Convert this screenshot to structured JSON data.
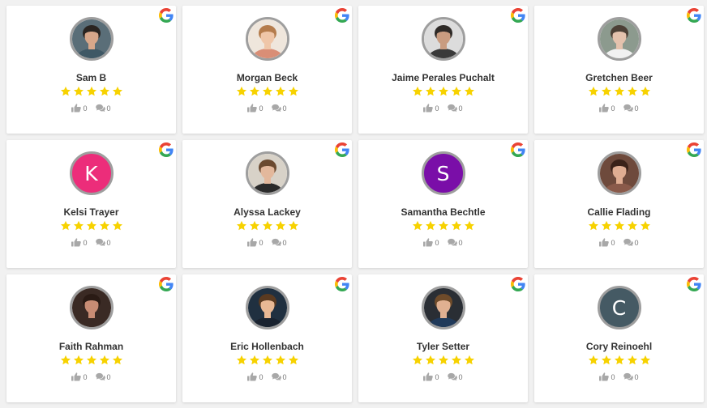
{
  "colors": {
    "star": "#f7d200",
    "avatar_border": "#9e9e9e"
  },
  "reviews": [
    {
      "name": "Sam B",
      "rating": 5,
      "likes": "0",
      "comments": "0",
      "avatar": {
        "type": "photo",
        "bg": "#5a6e78",
        "skin": "#d7a78a",
        "hair": "#2a2521",
        "shirt": "#3f5865"
      }
    },
    {
      "name": "Morgan Beck",
      "rating": 5,
      "likes": "0",
      "comments": "0",
      "avatar": {
        "type": "photo",
        "bg": "#efe6dc",
        "skin": "#efc6a8",
        "hair": "#b57c4c",
        "shirt": "#d98e76"
      }
    },
    {
      "name": "Jaime Perales Puchalt",
      "rating": 5,
      "likes": "0",
      "comments": "0",
      "avatar": {
        "type": "photo",
        "bg": "#dcdcdc",
        "skin": "#c99c80",
        "hair": "#2e2a27",
        "shirt": "#3a3a3a"
      }
    },
    {
      "name": "Gretchen Beer",
      "rating": 5,
      "likes": "0",
      "comments": "0",
      "avatar": {
        "type": "photo",
        "bg": "#8c9a8e",
        "skin": "#e4c2ad",
        "hair": "#4c4036",
        "shirt": "#f1f1f1"
      }
    },
    {
      "name": "Kelsi Trayer",
      "rating": 5,
      "likes": "0",
      "comments": "0",
      "avatar": {
        "type": "initial",
        "letter": "K",
        "bg": "#ec2d7a"
      }
    },
    {
      "name": "Alyssa Lackey",
      "rating": 5,
      "likes": "0",
      "comments": "0",
      "avatar": {
        "type": "photo",
        "bg": "#d8d2c8",
        "skin": "#e3b89c",
        "hair": "#6b4a30",
        "shirt": "#2a2a2a"
      }
    },
    {
      "name": "Samantha Bechtle",
      "rating": 5,
      "likes": "0",
      "comments": "0",
      "avatar": {
        "type": "initial",
        "letter": "S",
        "bg": "#7a0ea8"
      }
    },
    {
      "name": "Callie Flading",
      "rating": 5,
      "likes": "0",
      "comments": "0",
      "avatar": {
        "type": "photo",
        "bg": "#6e4a3c",
        "skin": "#e0ad92",
        "hair": "#3b2219",
        "shirt": "#8a5a4a"
      }
    },
    {
      "name": "Faith Rahman",
      "rating": 5,
      "likes": "0",
      "comments": "0",
      "avatar": {
        "type": "photo",
        "bg": "#3a2a24",
        "skin": "#c88c74",
        "hair": "#2a1b15",
        "shirt": "#3a2a24"
      }
    },
    {
      "name": "Eric Hollenbach",
      "rating": 5,
      "likes": "0",
      "comments": "0",
      "avatar": {
        "type": "photo",
        "bg": "#203040",
        "skin": "#e8b894",
        "hair": "#5a3a20",
        "shirt": "#1a2330"
      }
    },
    {
      "name": "Tyler Setter",
      "rating": 5,
      "likes": "0",
      "comments": "0",
      "avatar": {
        "type": "photo",
        "bg": "#2a2e34",
        "skin": "#e0b091",
        "hair": "#6e4b2a",
        "shirt": "#203a5a"
      }
    },
    {
      "name": "Cory Reinoehl",
      "rating": 5,
      "likes": "0",
      "comments": "0",
      "avatar": {
        "type": "initial",
        "letter": "C",
        "bg": "#455a64"
      }
    }
  ]
}
